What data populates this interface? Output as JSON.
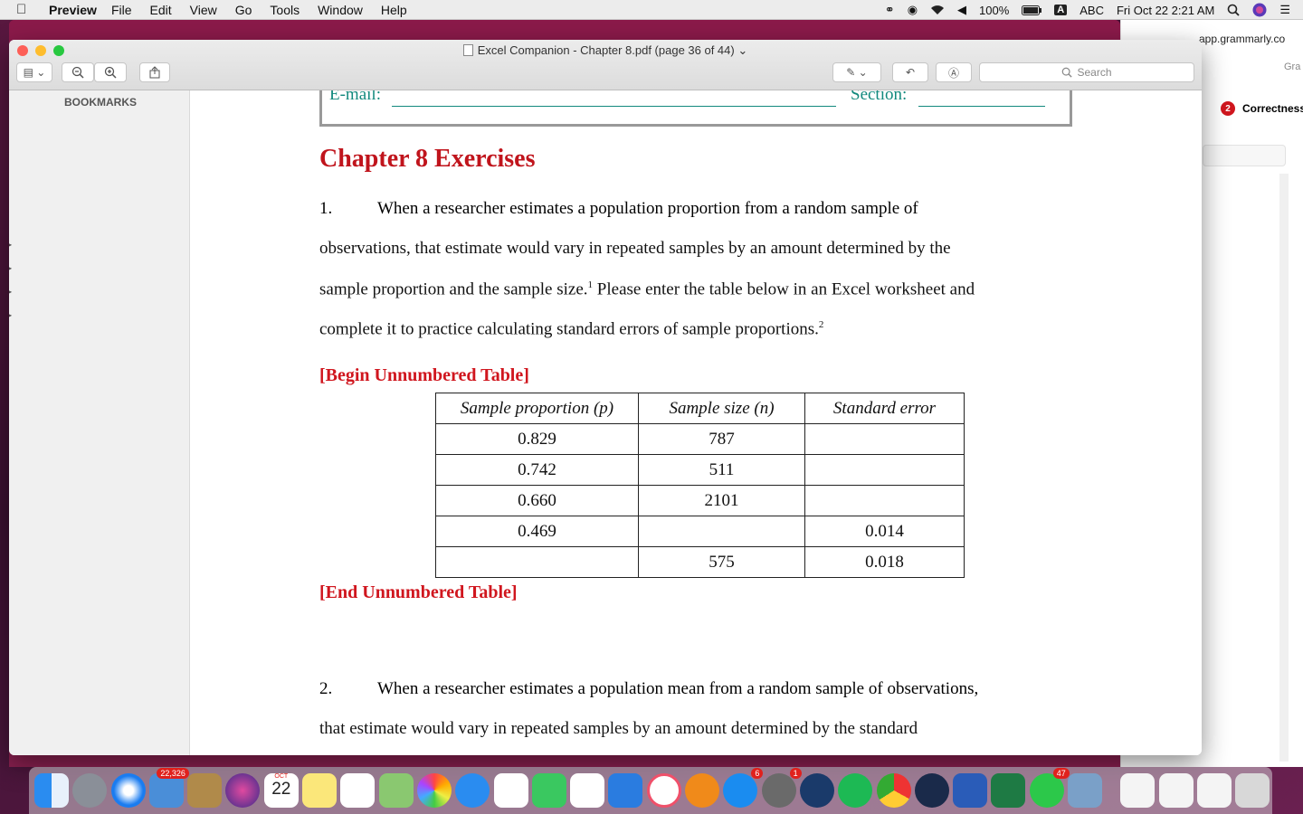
{
  "menubar": {
    "app": "Preview",
    "items": [
      "File",
      "Edit",
      "View",
      "Go",
      "Tools",
      "Window",
      "Help"
    ],
    "battery": "100%",
    "input_source": "ABC",
    "datetime": "Fri Oct 22  2:21 AM"
  },
  "grammarly": {
    "url": "app.grammarly.co",
    "brand": "Gra",
    "correctness_count": "2",
    "correctness_label": "Correctness"
  },
  "window": {
    "title": "Excel Companion - Chapter 8.pdf (page 36 of 44)",
    "search_placeholder": "Search"
  },
  "sidebar": {
    "header": "BOOKMARKS"
  },
  "document": {
    "email_label": "E-mail:",
    "section_label": "Section:",
    "heading": "Chapter 8 Exercises",
    "q1_number": "1.",
    "q1_lines": [
      "When a researcher estimates a population proportion from a random sample of",
      "observations, that estimate would vary in repeated samples by an amount determined by the",
      "sample proportion and the sample size.",
      " Please enter the table below in an Excel worksheet and",
      "complete it to practice calculating standard errors of sample proportions."
    ],
    "footnote1": "1",
    "footnote2": "2",
    "begin_table": "[Begin Unnumbered Table]",
    "end_table": "[End Unnumbered Table]",
    "table": {
      "headers": [
        "Sample proportion (p)",
        "Sample size (n)",
        "Standard error"
      ],
      "rows": [
        [
          "0.829",
          "787",
          ""
        ],
        [
          "0.742",
          "511",
          ""
        ],
        [
          "0.660",
          "2101",
          ""
        ],
        [
          "0.469",
          "",
          "0.014"
        ],
        [
          "",
          "575",
          "0.018"
        ]
      ]
    },
    "q2_number": "2.",
    "q2_lines": [
      "When a researcher estimates a population mean from a random sample of observations,",
      "that estimate would vary in repeated samples by an amount determined by the standard"
    ]
  },
  "dock": {
    "mail_badge": "22,326",
    "calendar_month": "OCT",
    "calendar_day": "22",
    "appstore_badge": "6",
    "prefs_badge": "1",
    "whatsapp_badge": "47"
  }
}
